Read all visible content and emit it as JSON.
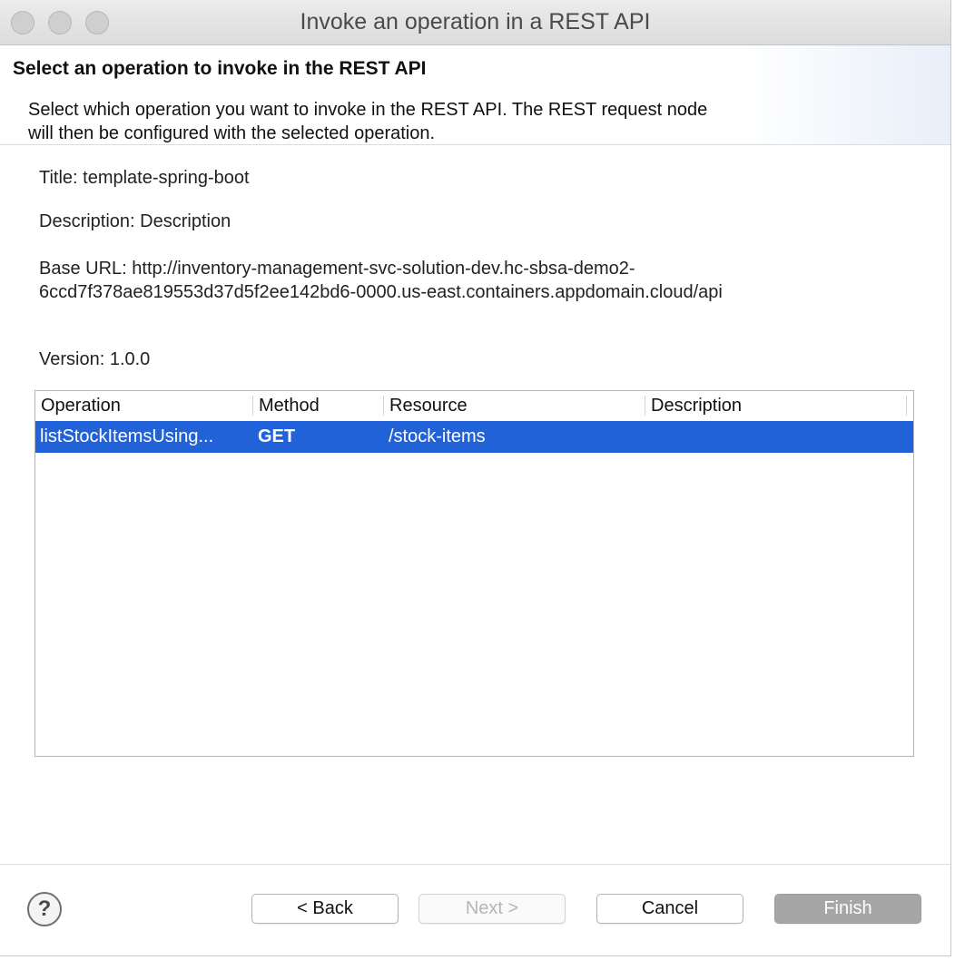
{
  "window": {
    "title": "Invoke an operation in a REST API"
  },
  "header": {
    "title": "Select an operation to invoke in the REST API",
    "description": "Select which operation you want to invoke in the REST API. The REST request node will then be configured with the selected operation."
  },
  "info": {
    "title": "Title: template-spring-boot",
    "description": "Description: Description",
    "base_url": "Base URL: http://inventory-management-svc-solution-dev.hc-sbsa-demo2-6ccd7f378ae819553d37d5f2ee142bd6-0000.us-east.containers.appdomain.cloud/api",
    "version": "Version: 1.0.0"
  },
  "table": {
    "columns": [
      "Operation",
      "Method",
      "Resource",
      "Description"
    ],
    "rows": [
      {
        "operation": "listStockItemsUsing...",
        "method": "GET",
        "resource": "/stock-items",
        "description": ""
      }
    ]
  },
  "buttons": {
    "help": "?",
    "back": "< Back",
    "next": "Next >",
    "cancel": "Cancel",
    "finish": "Finish"
  },
  "colors": {
    "selection": "#2162d8",
    "finish_bg": "#a6a6a6"
  }
}
